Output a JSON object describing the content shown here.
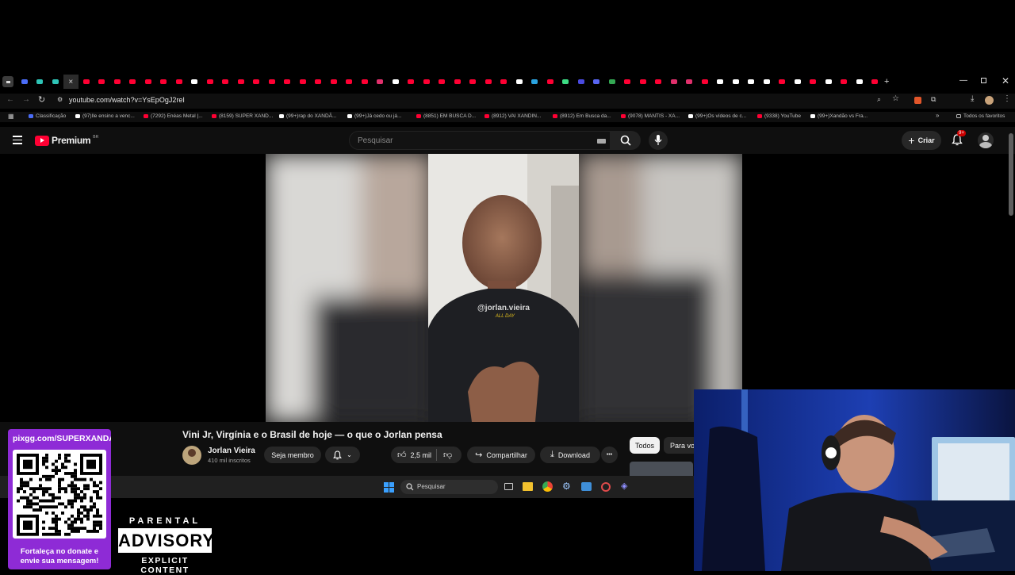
{
  "browser": {
    "url": "youtube.com/watch?v=YsEpOgJ2reI",
    "tab_close_label": "×",
    "new_tab_label": "+",
    "bookmarks": [
      {
        "label": "Classificação",
        "color": "#4a6cf7"
      },
      {
        "label": "(97)Ile ensino a venc...",
        "color": "#ffffff"
      },
      {
        "label": "(7292) Enéas Metal |...",
        "color": "#ff0033"
      },
      {
        "label": "(8159) SUPER XAND...",
        "color": "#ff0033"
      },
      {
        "label": "(99+)rap do XANDÃ...",
        "color": "#ffffff"
      },
      {
        "label": "(99+)Já cedo ou já...",
        "color": "#ffffff"
      },
      {
        "label": "(8851) EM BUSCA D...",
        "color": "#ff0033"
      },
      {
        "label": "(8912) VAI XANDIN...",
        "color": "#ff0033"
      },
      {
        "label": "(8912) Em Busca da...",
        "color": "#ff0033"
      },
      {
        "label": "(9078) MANTIS - XA...",
        "color": "#ff0033"
      },
      {
        "label": "(99+)Os vídeos de c...",
        "color": "#ffffff"
      },
      {
        "label": "(9338) YouTube",
        "color": "#ff0033"
      },
      {
        "label": "(99+)Xandão vs Fra...",
        "color": "#ffffff"
      }
    ],
    "all_favorites": "Todos os favoritos"
  },
  "youtube": {
    "logo_text": "Premium",
    "region": "BR",
    "search_placeholder": "Pesquisar",
    "create_label": "Criar",
    "notif_badge": "9+",
    "video": {
      "overlay_handle": "@jorlan.vieira",
      "overlay_sub": "ALL DAY"
    },
    "title": "Vini Jr, Virgínia e o Brasil de hoje — o que o Jorlan pensa",
    "channel": {
      "name": "Jorlan Vieira",
      "subs": "410 mil inscritos"
    },
    "join_label": "Seja membro",
    "likes": "2,5 mil",
    "share_label": "Compartilhar",
    "download_label": "Download",
    "more_label": "•••",
    "chips": [
      "Todos",
      "Para vo"
    ]
  },
  "taskbar": {
    "search_placeholder": "Pesquisar"
  },
  "stream_overlay": {
    "donate_url": "pixgg.com/SUPERXANDA",
    "donate_text_1": "Fortaleça no donate e",
    "donate_text_2": "envie sua mensagem!",
    "advisory_top": "PARENTAL",
    "advisory_mid": "ADVISORY",
    "advisory_bottom": "EXPLICIT CONTENT"
  },
  "colors": {
    "yt_red": "#ff0033",
    "qr_panel": "#8e2bd6",
    "bg": "#0f0f0f"
  }
}
